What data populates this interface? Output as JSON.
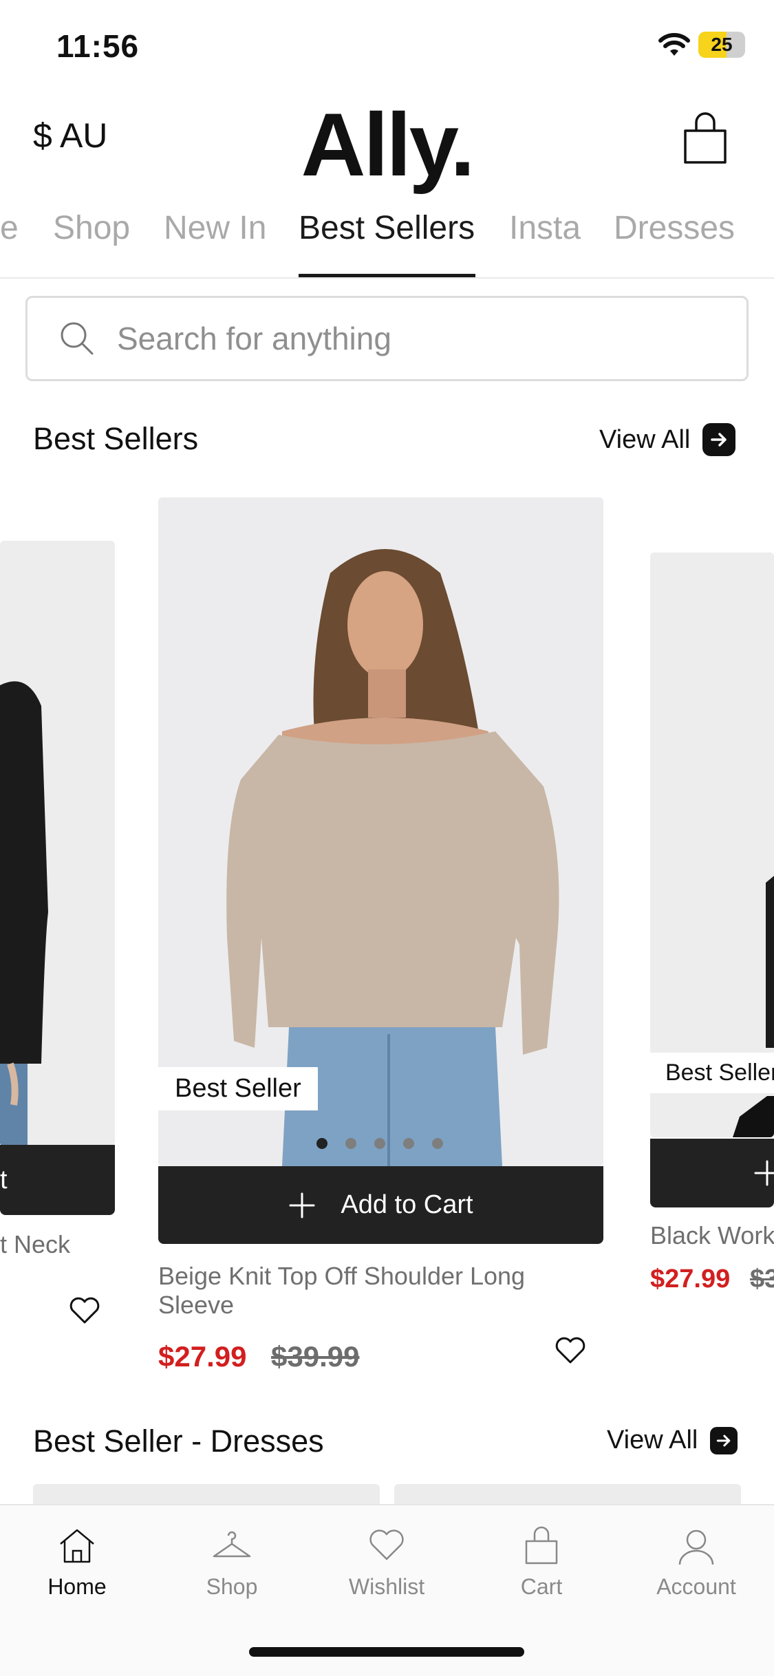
{
  "status_bar": {
    "time": "11:56",
    "battery": "25"
  },
  "header": {
    "currency": "$ AU",
    "logo": "Ally."
  },
  "tabs": [
    {
      "label": "e"
    },
    {
      "label": "Shop"
    },
    {
      "label": "New In"
    },
    {
      "label": "Best Sellers",
      "active": true
    },
    {
      "label": "Insta"
    },
    {
      "label": "Dresses"
    }
  ],
  "search": {
    "placeholder": "Search for anything"
  },
  "best_sellers": {
    "title": "Best Sellers",
    "view_all": "View All",
    "left_card": {
      "add_to_cart": "t",
      "name": "t Neck"
    },
    "main_card": {
      "badge": "Best Seller",
      "add_to_cart": "Add to Cart",
      "name": "Beige Knit Top Off Shoulder Long Sleeve",
      "price": "$27.99",
      "old_price": "$39.99"
    },
    "right_card": {
      "badge": "Best Seller",
      "name": "Black Workw",
      "price": "$27.99",
      "old_price": "$3"
    }
  },
  "best_seller_dresses": {
    "title": "Best Seller - Dresses",
    "view_all": "View All"
  },
  "bottom_nav": {
    "home": "Home",
    "shop": "Shop",
    "wishlist": "Wishlist",
    "cart": "Cart",
    "account": "Account"
  },
  "icons": [
    "wifi-icon",
    "battery-icon",
    "shopping-bag-icon",
    "search-icon",
    "arrow-right-icon",
    "plus-icon",
    "heart-icon",
    "home-icon",
    "hanger-icon",
    "cart-icon",
    "account-icon"
  ],
  "colors": {
    "sale_price": "#d21f1f",
    "button_dark": "#222222",
    "tab_inactive": "#a9a9a9"
  }
}
